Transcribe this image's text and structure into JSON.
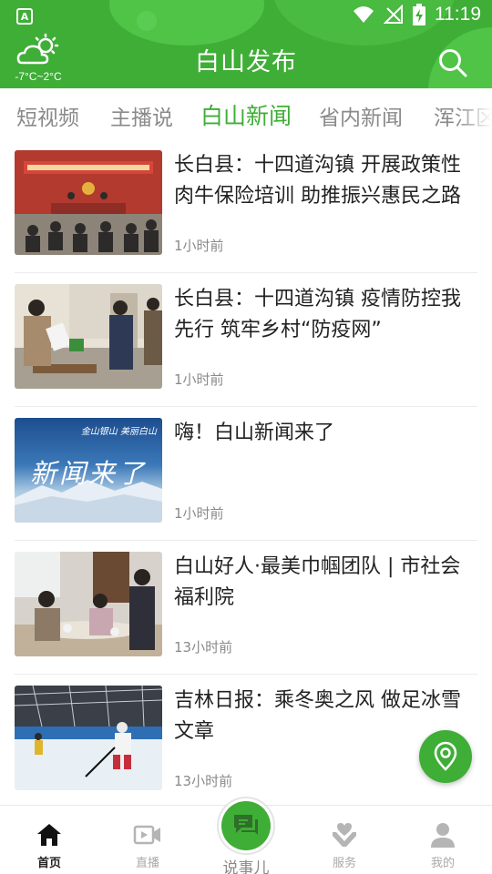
{
  "status_bar": {
    "time": "11:19",
    "indicator": "A"
  },
  "header": {
    "title": "白山发布",
    "weather": {
      "icon": "cloudy-sun-icon",
      "temperature": "-7°C~2°C"
    },
    "search_icon": "search-icon"
  },
  "tabs": [
    {
      "label": "短视频",
      "active": false
    },
    {
      "label": "主播说",
      "active": false
    },
    {
      "label": "白山新闻",
      "active": true
    },
    {
      "label": "省内新闻",
      "active": false
    },
    {
      "label": "浑江区",
      "active": false
    }
  ],
  "news": [
    {
      "title": "长白县：十四道沟镇 开展政策性肉牛保险培训 助推振兴惠民之路",
      "time": "1小时前"
    },
    {
      "title": "长白县：十四道沟镇 疫情防控我先行 筑牢乡村“防疫网”",
      "time": "1小时前"
    },
    {
      "title": "嗨！白山新闻来了",
      "time": "1小时前",
      "thumb_text": "新闻来了",
      "thumb_subtext": "金山银山 美丽白山"
    },
    {
      "title": "白山好人·最美巾帼团队 | 市社会福利院",
      "time": "13小时前"
    },
    {
      "title": "吉林日报：乘冬奥之风 做足冰雪文章",
      "time": "13小时前"
    }
  ],
  "fab": {
    "icon": "location-pin-icon"
  },
  "bottom_nav": {
    "items": [
      {
        "label": "首页",
        "icon": "home-icon",
        "active": true
      },
      {
        "label": "直播",
        "icon": "video-icon",
        "active": false
      },
      {
        "label": "说事儿",
        "icon": "chat-icon",
        "active": false
      },
      {
        "label": "服务",
        "icon": "heart-hand-icon",
        "active": false
      },
      {
        "label": "我的",
        "icon": "user-icon",
        "active": false
      }
    ]
  },
  "colors": {
    "brand_green": "#3fae37",
    "inactive_gray": "#8a8a8a"
  }
}
